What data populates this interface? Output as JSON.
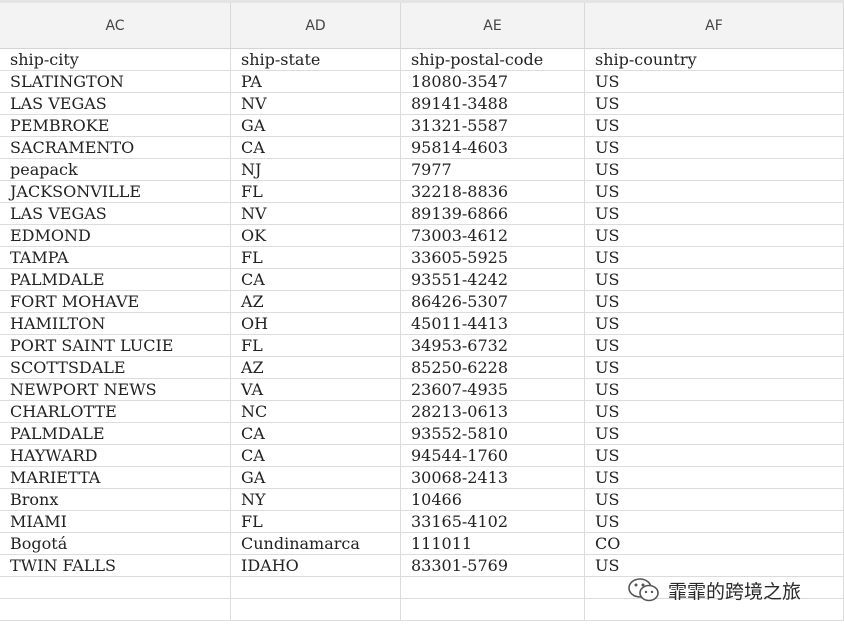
{
  "columns": [
    "AC",
    "AD",
    "AE",
    "AF"
  ],
  "header_row": [
    "ship-city",
    "ship-state",
    "ship-postal-code",
    "ship-country"
  ],
  "rows": [
    [
      "SLATINGTON",
      "PA",
      "18080-3547",
      "US"
    ],
    [
      "LAS VEGAS",
      "NV",
      "89141-3488",
      "US"
    ],
    [
      "PEMBROKE",
      "GA",
      "31321-5587",
      "US"
    ],
    [
      "SACRAMENTO",
      "CA",
      "95814-4603",
      "US"
    ],
    [
      "peapack",
      "NJ",
      "7977",
      "US"
    ],
    [
      "JACKSONVILLE",
      "FL",
      "32218-8836",
      "US"
    ],
    [
      "LAS VEGAS",
      "NV",
      "89139-6866",
      "US"
    ],
    [
      "EDMOND",
      "OK",
      "73003-4612",
      "US"
    ],
    [
      "TAMPA",
      "FL",
      "33605-5925",
      "US"
    ],
    [
      "PALMDALE",
      "CA",
      "93551-4242",
      "US"
    ],
    [
      "FORT MOHAVE",
      "AZ",
      "86426-5307",
      "US"
    ],
    [
      "HAMILTON",
      "OH",
      "45011-4413",
      "US"
    ],
    [
      "PORT SAINT LUCIE",
      "FL",
      "34953-6732",
      "US"
    ],
    [
      "SCOTTSDALE",
      "AZ",
      "85250-6228",
      "US"
    ],
    [
      "NEWPORT NEWS",
      "VA",
      "23607-4935",
      "US"
    ],
    [
      "CHARLOTTE",
      "NC",
      "28213-0613",
      "US"
    ],
    [
      "PALMDALE",
      "CA",
      "93552-5810",
      "US"
    ],
    [
      "HAYWARD",
      "CA",
      "94544-1760",
      "US"
    ],
    [
      "MARIETTA",
      "GA",
      "30068-2413",
      "US"
    ],
    [
      "Bronx",
      "NY",
      "10466",
      "US"
    ],
    [
      "MIAMI",
      "FL",
      "33165-4102",
      "US"
    ],
    [
      "Bogotá",
      "Cundinamarca",
      "111011",
      "CO"
    ],
    [
      "TWIN FALLS",
      "IDAHO",
      "83301-5769",
      "US"
    ],
    [
      "",
      "",
      "",
      ""
    ],
    [
      "",
      "",
      "",
      ""
    ]
  ],
  "watermark": {
    "text": "霏霏的跨境之旅",
    "icon": "wechat-icon"
  }
}
